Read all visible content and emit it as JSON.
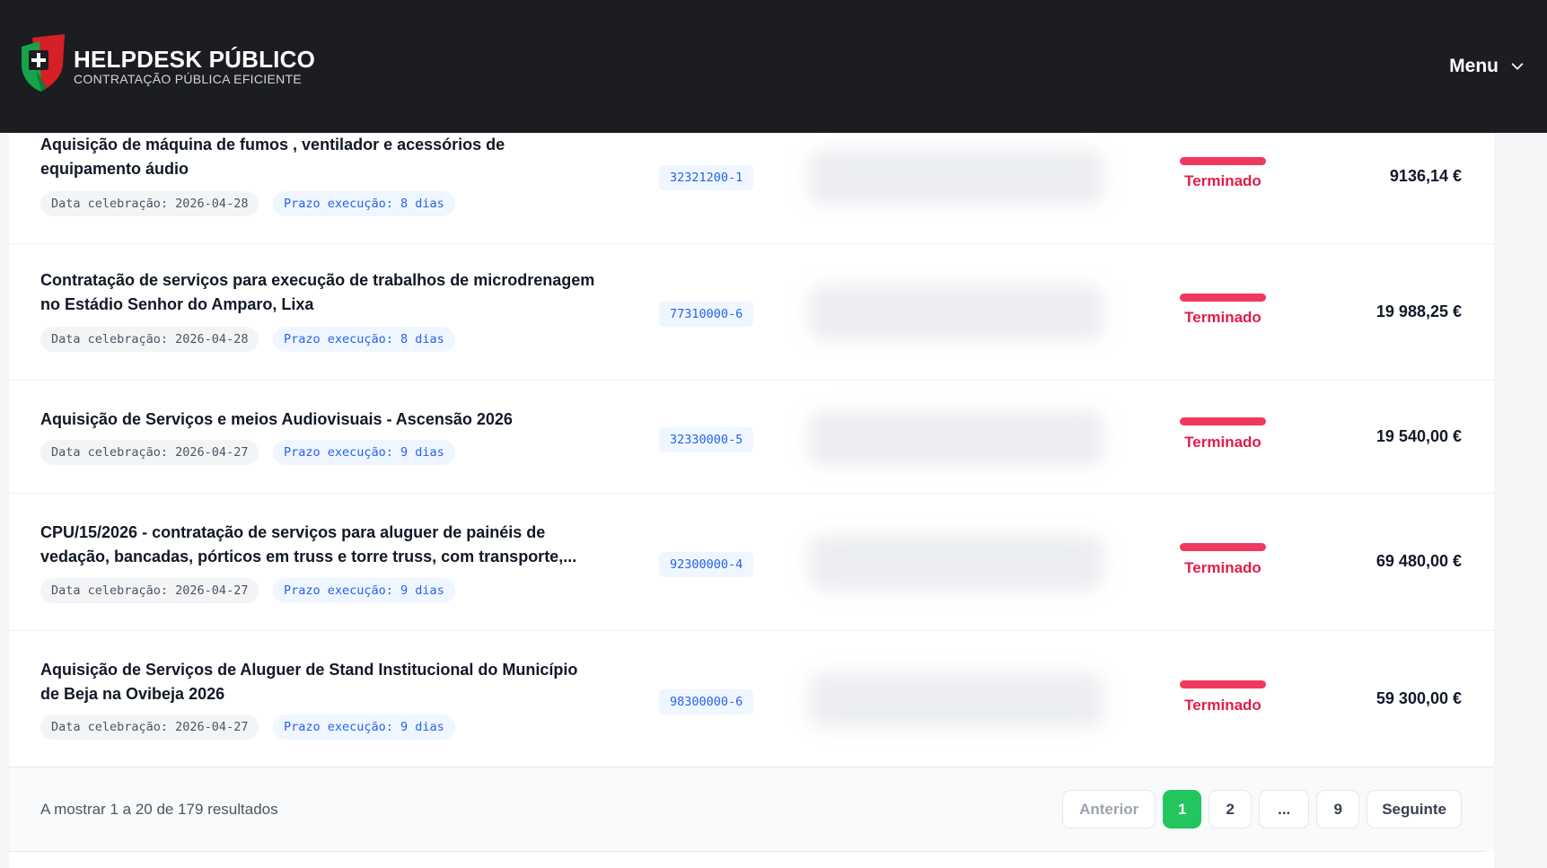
{
  "header": {
    "brand_title": "HELPDESK PÚBLICO",
    "brand_subtitle": "CONTRATAÇÃO PÚBLICA EFICIENTE",
    "menu_label": "Menu"
  },
  "rows": [
    {
      "title": "Aquisição de máquina de fumos , ventilador e acessórios de equipamento áudio",
      "date": "Data celebração: 2026-04-28",
      "prazo": "Prazo execução: 8 dias",
      "cpv": "32321200-1",
      "status": "Terminado",
      "price": "9136,14 €"
    },
    {
      "title": "Contratação de serviços para execução de trabalhos de microdrenagem no Estádio Senhor do Amparo, Lixa",
      "date": "Data celebração: 2026-04-28",
      "prazo": "Prazo execução: 8 dias",
      "cpv": "77310000-6",
      "status": "Terminado",
      "price": "19 988,25 €"
    },
    {
      "title": "Aquisição de Serviços e meios Audiovisuais - Ascensão 2026",
      "date": "Data celebração: 2026-04-27",
      "prazo": "Prazo execução: 9 dias",
      "cpv": "32330000-5",
      "status": "Terminado",
      "price": "19 540,00 €"
    },
    {
      "title": "CPU/15/2026 - contratação de serviços para aluguer de painéis de vedação, bancadas, pórticos em truss e torre truss, com transporte,...",
      "date": "Data celebração: 2026-04-27",
      "prazo": "Prazo execução: 9 dias",
      "cpv": "92300000-4",
      "status": "Terminado",
      "price": "69 480,00 €"
    },
    {
      "title": "Aquisição de Serviços de Aluguer de Stand Institucional do Município de Beja na Ovibeja 2026",
      "date": "Data celebração: 2026-04-27",
      "prazo": "Prazo execução: 9 dias",
      "cpv": "98300000-6",
      "status": "Terminado",
      "price": "59 300,00 €"
    }
  ],
  "pagination": {
    "results_text": "A mostrar 1 a 20 de 179 resultados",
    "prev_label": "Anterior",
    "pages": [
      "1",
      "2",
      "...",
      "9"
    ],
    "next_label": "Seguinte"
  },
  "colors": {
    "header_bg": "#1c1d21",
    "status_red": "#f0385e",
    "active_page": "#22c55e",
    "cpv_blue": "#2563eb"
  }
}
